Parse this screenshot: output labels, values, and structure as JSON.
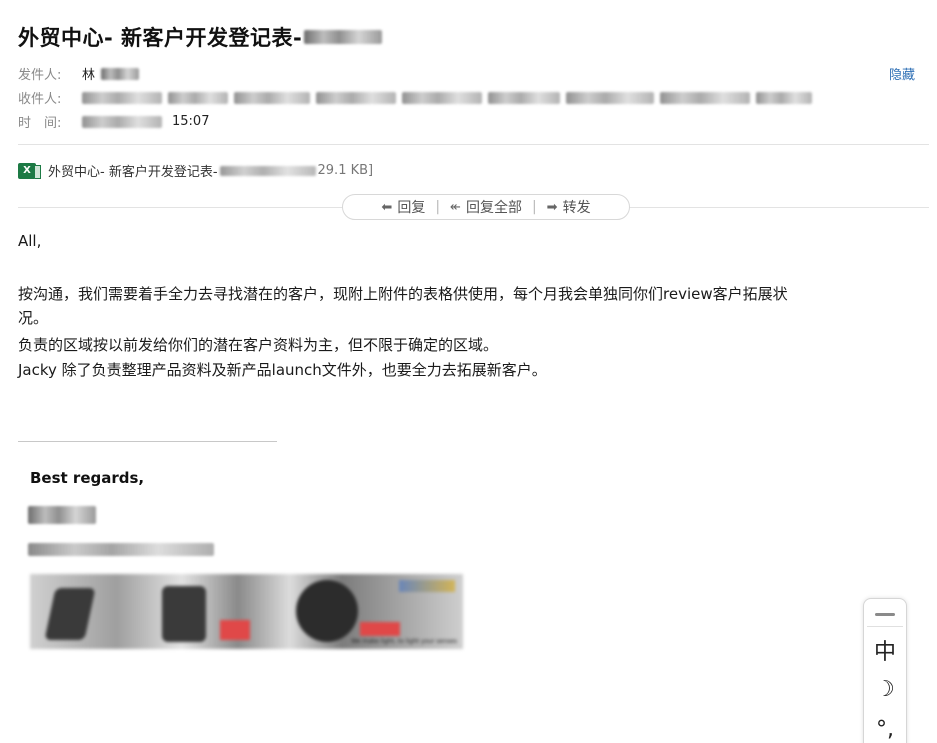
{
  "email": {
    "subject": "外贸中心- 新客户开发登记表-",
    "hide_label": "隐藏",
    "sender_label": "发件人:",
    "sender_name": "林",
    "recipient_label": "收件人:",
    "time_label": "时　间:",
    "time_value": "15:07",
    "attachment": {
      "name": "外贸中心- 新客户开发登记表-",
      "size": "29.1 KB]"
    },
    "actions": {
      "reply": "回复",
      "reply_all": "回复全部",
      "forward": "转发"
    },
    "body": {
      "greeting": "All,",
      "line1": "按沟通，我们需要着手全力去寻找潜在的客户，现附上附件的表格供使用，每个月我会单独同你们review客户拓展状",
      "line1b": "况。",
      "line2": "负责的区域按以前发给你们的潜在客户资料为主，但不限于确定的区域。",
      "line3": "Jacky 除了负责整理产品资料及新产品launch文件外，也要全力去拓展新客户。"
    },
    "signature": {
      "regards": "Best regards,",
      "banner_tag": "We make light, to light your senses"
    }
  },
  "ime": {
    "lang": "中",
    "moon": "☽",
    "punct": "°,"
  },
  "colors": {
    "link": "#2e6fb5",
    "excel_green": "#1d7a45"
  }
}
